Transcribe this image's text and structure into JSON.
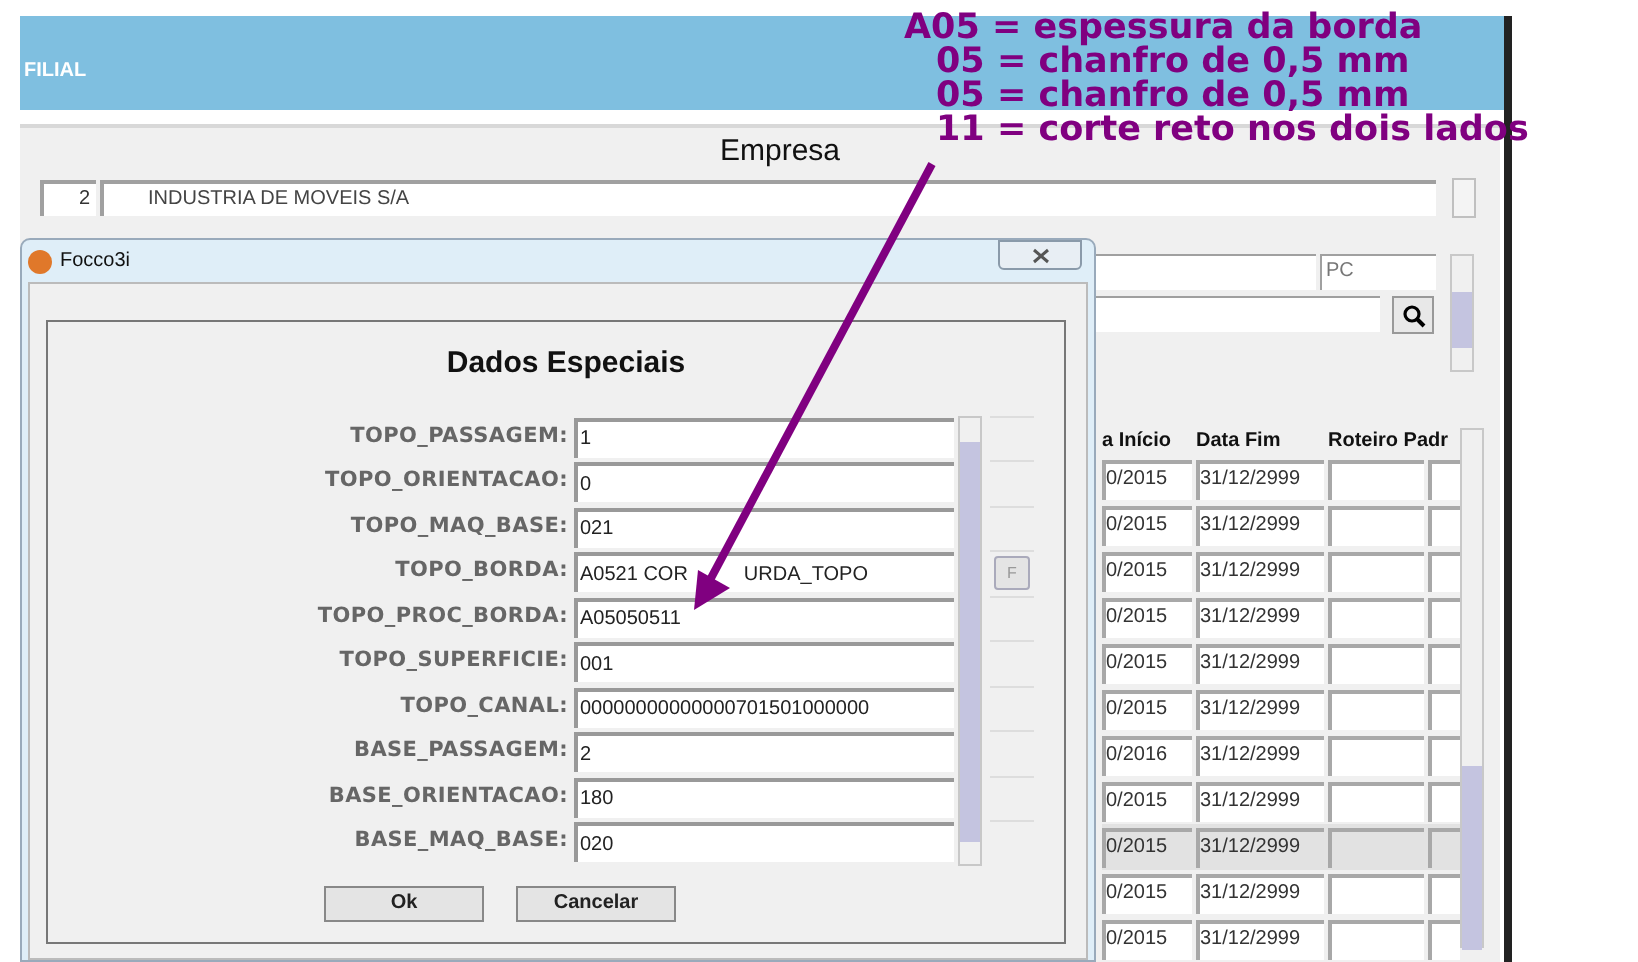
{
  "header": {
    "title": "FILIAL"
  },
  "main_window": {
    "title": "Empresa",
    "company_code": "2",
    "company_name": "INDUSTRIA DE MOVEIS S/A",
    "unit": "PC",
    "table": {
      "columns": [
        "a Início",
        "Data Fim",
        "Roteiro Padr"
      ],
      "rows": [
        {
          "start": "0/2015",
          "end": "31/12/2999",
          "selected": false
        },
        {
          "start": "0/2015",
          "end": "31/12/2999",
          "selected": false
        },
        {
          "start": "0/2015",
          "end": "31/12/2999",
          "selected": false
        },
        {
          "start": "0/2015",
          "end": "31/12/2999",
          "selected": false
        },
        {
          "start": "0/2015",
          "end": "31/12/2999",
          "selected": false
        },
        {
          "start": "0/2015",
          "end": "31/12/2999",
          "selected": false
        },
        {
          "start": "0/2016",
          "end": "31/12/2999",
          "selected": false
        },
        {
          "start": "0/2015",
          "end": "31/12/2999",
          "selected": false
        },
        {
          "start": "0/2015",
          "end": "31/12/2999",
          "selected": true
        },
        {
          "start": "0/2015",
          "end": "31/12/2999",
          "selected": false
        },
        {
          "start": "0/2015",
          "end": "31/12/2999",
          "selected": false
        }
      ]
    }
  },
  "dialog": {
    "title": "Focco3i",
    "heading": "Dados Especiais",
    "fields": [
      {
        "label": "TOPO_PASSAGEM:",
        "value": "1",
        "kind": "text"
      },
      {
        "label": "TOPO_ORIENTACAO:",
        "value": "0",
        "kind": "text"
      },
      {
        "label": "TOPO_MAQ_BASE:",
        "value": "021",
        "kind": "text"
      },
      {
        "label": "TOPO_BORDA:",
        "value": "A0521 COR",
        "value_tail": "URDA_TOPO",
        "kind": "lookup",
        "button": "F"
      },
      {
        "label": "TOPO_PROC_BORDA:",
        "value": "A05050511",
        "kind": "text"
      },
      {
        "label": "TOPO_SUPERFICIE:",
        "value": "001",
        "kind": "text"
      },
      {
        "label": "TOPO_CANAL:",
        "value": "00000000000000701501000000",
        "kind": "text"
      },
      {
        "label": "BASE_PASSAGEM:",
        "value": "2",
        "kind": "text"
      },
      {
        "label": "BASE_ORIENTACAO:",
        "value": "180",
        "kind": "text"
      },
      {
        "label": "BASE_MAQ_BASE:",
        "value": "020",
        "kind": "text"
      }
    ],
    "buttons": [
      "Ok",
      "Cancelar"
    ]
  },
  "annotation": {
    "lines": [
      "A05 = espessura da borda",
      "05 = chanfro de 0,5 mm",
      "05 = chanfro de 0,5 mm",
      "11 = corte reto nos dois lados"
    ]
  }
}
